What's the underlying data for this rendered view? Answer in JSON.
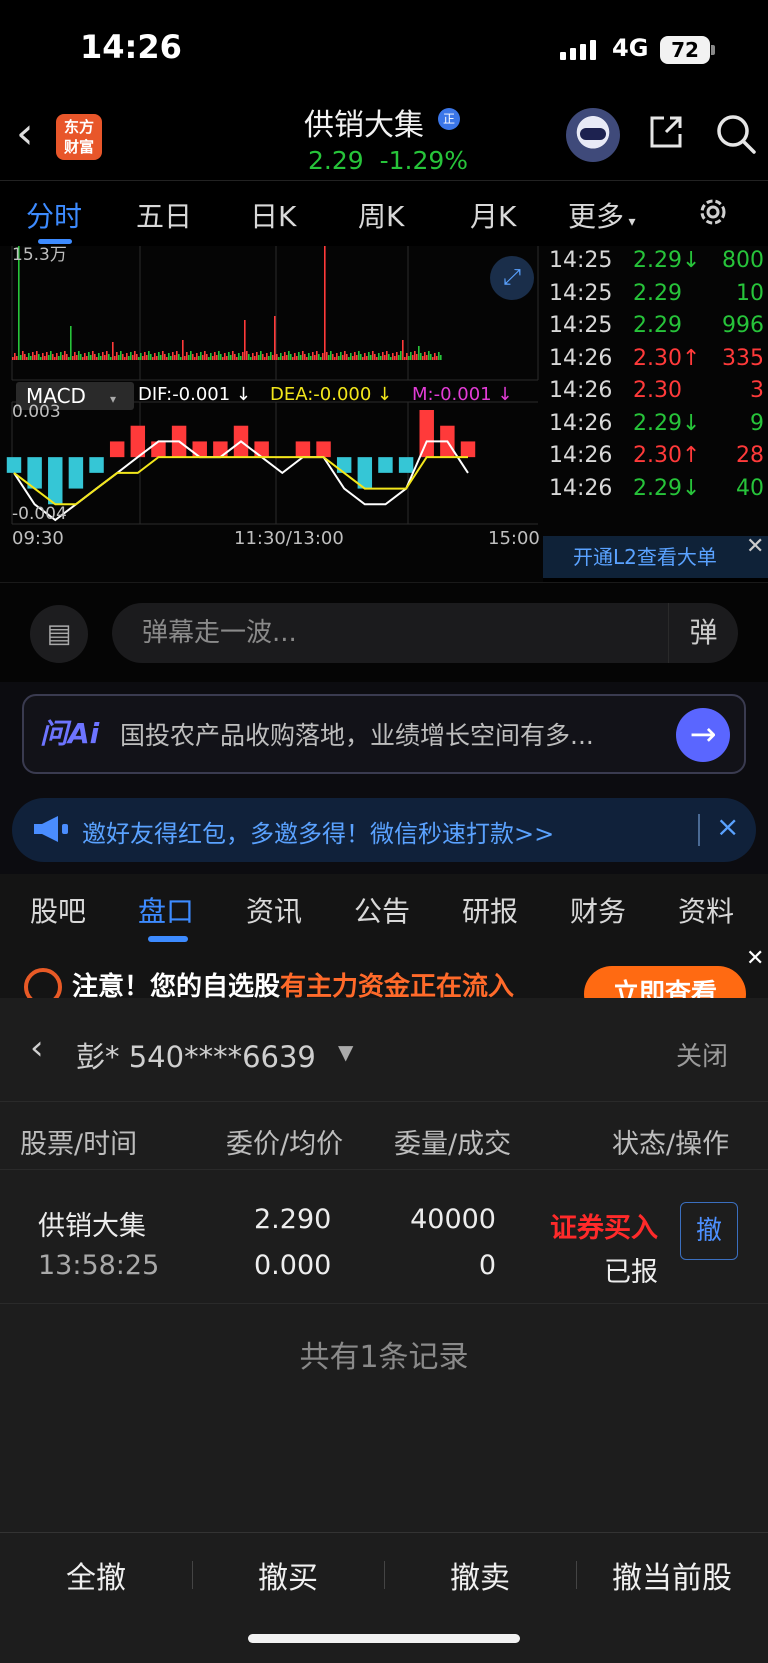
{
  "status_bar": {
    "time": "14:26",
    "network": "4G",
    "battery": "72"
  },
  "header": {
    "back_glyph": "‹",
    "app_logo": [
      "东方",
      "财富"
    ],
    "stock_name": "供销大集",
    "stock_badge": "正",
    "price": "2.29",
    "change_pct": "-1.29%",
    "icons": [
      "back-icon",
      "robot-avatar-icon",
      "share-icon",
      "search-icon"
    ]
  },
  "chart_tabs": {
    "items": [
      "分时",
      "五日",
      "日K",
      "周K",
      "月K",
      "更多"
    ],
    "active": "分时",
    "settings_icon": "gear-icon"
  },
  "chart": {
    "volume_max_label": "15.3万",
    "macd_selector": "MACD",
    "dif": "DIF:-0.001 ↓",
    "dea": "DEA:-0.000 ↓",
    "m": "M:-0.001 ↓",
    "macd_top": "0.003",
    "macd_bottom": "-0.004",
    "time_labels": [
      "09:30",
      "11:30/13:00",
      "15:00"
    ],
    "colors": {
      "dif": "#ffffff",
      "dea": "#f2e61b",
      "m": "#e23cd6",
      "up": "#ff3a3a",
      "down": "#27c43a",
      "hist_down": "#35c6d6"
    }
  },
  "chart_data": {
    "type": "bar",
    "title": "",
    "xlabel": "",
    "ylabel": "",
    "series": [
      {
        "name": "MACD",
        "values": [
          -0.001,
          -0.002,
          -0.003,
          -0.002,
          -0.001,
          0.001,
          0.002,
          0.001,
          0.002,
          0.001,
          0.001,
          0.002,
          0.001,
          0.0,
          0.001,
          0.001,
          -0.001,
          -0.002,
          -0.001,
          -0.001,
          0.003,
          0.002,
          0.001
        ]
      },
      {
        "name": "DIF",
        "values": [
          -0.001,
          -0.003,
          -0.004,
          -0.003,
          -0.002,
          -0.001,
          0.0,
          0.001,
          0.001,
          0.0,
          0.0,
          0.001,
          0.0,
          -0.001,
          0.0,
          0.0,
          -0.002,
          -0.003,
          -0.003,
          -0.002,
          0.001,
          0.001,
          -0.001
        ]
      },
      {
        "name": "DEA",
        "values": [
          -0.001,
          -0.002,
          -0.003,
          -0.003,
          -0.002,
          -0.001,
          -0.001,
          0.0,
          0.0,
          0.0,
          0.0,
          0.0,
          0.0,
          0.0,
          0.0,
          0.0,
          -0.001,
          -0.002,
          -0.002,
          -0.002,
          0.0,
          0.0,
          0.0
        ]
      }
    ],
    "ylim": [
      -0.004,
      0.003
    ]
  },
  "trades": [
    {
      "time": "14:25",
      "price": "2.29↓",
      "vol": "800",
      "dir": "down"
    },
    {
      "time": "14:25",
      "price": "2.29",
      "vol": "10",
      "dir": "down"
    },
    {
      "time": "14:25",
      "price": "2.29",
      "vol": "996",
      "dir": "down"
    },
    {
      "time": "14:26",
      "price": "2.30↑",
      "vol": "335",
      "dir": "up"
    },
    {
      "time": "14:26",
      "price": "2.30",
      "vol": "3",
      "dir": "up"
    },
    {
      "time": "14:26",
      "price": "2.29↓",
      "vol": "9",
      "dir": "down"
    },
    {
      "time": "14:26",
      "price": "2.30↑",
      "vol": "28",
      "dir": "up"
    },
    {
      "time": "14:26",
      "price": "2.29↓",
      "vol": "40",
      "dir": "down"
    }
  ],
  "l2_banner": "开通L2查看大单",
  "danmu": {
    "placeholder": "弹幕走一波...",
    "button": "弹"
  },
  "ai": {
    "logo": "问Ai",
    "text": "国投农产品收购落地，业绩增长空间有多...",
    "go": "→"
  },
  "promo": {
    "text": "邀好友得红包，多邀多得！微信秒速打款>>",
    "close": "×"
  },
  "section_tabs": {
    "items": [
      "股吧",
      "盘口",
      "资讯",
      "公告",
      "研报",
      "财务",
      "资料"
    ],
    "active": "盘口"
  },
  "notice": {
    "text_a": "注意！您的自选股",
    "text_b": "有主力资金正在流入",
    "button": "立即查看"
  },
  "order_panel": {
    "account": "彭*  540****6639",
    "close": "关闭",
    "columns": [
      "股票/时间",
      "委价/均价",
      "委量/成交",
      "状态/操作"
    ],
    "order": {
      "name": "供销大集",
      "time": "13:58:25",
      "entrust_price": "2.290",
      "avg_price": "0.000",
      "entrust_qty": "40000",
      "filled_qty": "0",
      "type": "证券买入",
      "status": "已报",
      "cancel": "撤"
    },
    "record_count": "共有1条记录"
  },
  "actions": [
    "全撤",
    "撤买",
    "撤卖",
    "撤当前股"
  ]
}
